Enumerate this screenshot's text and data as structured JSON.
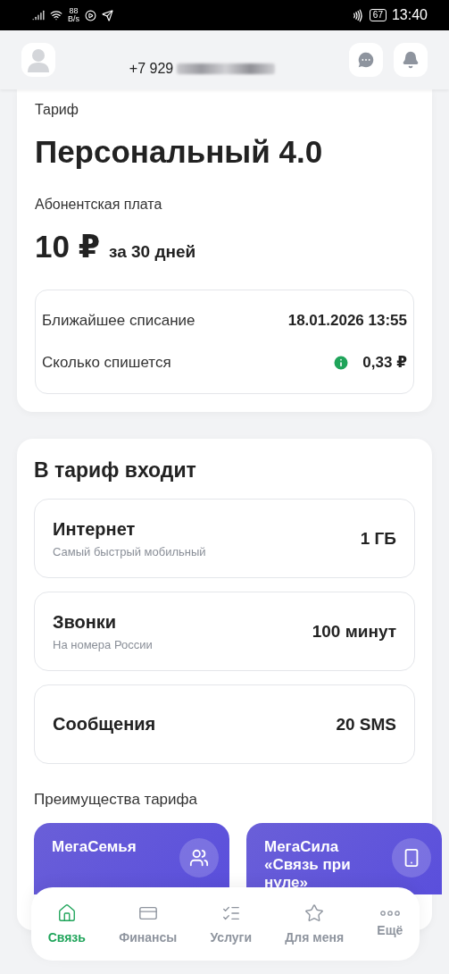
{
  "status_bar": {
    "speed_value": "88",
    "speed_unit": "B/s",
    "battery": "67",
    "time": "13:40"
  },
  "header": {
    "phone": "+7 929"
  },
  "tariff": {
    "label": "Тариф",
    "name": "Персональный 4.0",
    "fee_label": "Абонентская плата",
    "price": "10 ₽",
    "period": "за 30 дней",
    "charges": [
      {
        "label": "Ближайшее списание",
        "value": "18.01.2026 13:55",
        "info": false
      },
      {
        "label": "Сколько спишется",
        "value": "0,33 ₽",
        "info": true
      }
    ]
  },
  "included": {
    "title": "В тариф входит",
    "items": [
      {
        "name": "Интернет",
        "subtitle": "Самый быстрый мобильный",
        "value": "1 ГБ"
      },
      {
        "name": "Звонки",
        "subtitle": "На номера России",
        "value": "100 минут"
      },
      {
        "name": "Сообщения",
        "value": "20 SMS"
      }
    ],
    "benefits_title": "Преимущества тарифа",
    "benefits": [
      {
        "title": "МегаСемья",
        "kind": "family"
      },
      {
        "title": "МегаСила «Связь при нуле»",
        "kind": "sim"
      }
    ]
  },
  "nav": [
    {
      "label": "Связь",
      "kind": "home",
      "selected": true
    },
    {
      "label": "Финансы",
      "kind": "finance",
      "selected": false
    },
    {
      "label": "Услуги",
      "kind": "services",
      "selected": false
    },
    {
      "label": "Для меня",
      "kind": "star",
      "selected": false
    },
    {
      "label": "Ещё",
      "kind": "more",
      "selected": false
    }
  ]
}
